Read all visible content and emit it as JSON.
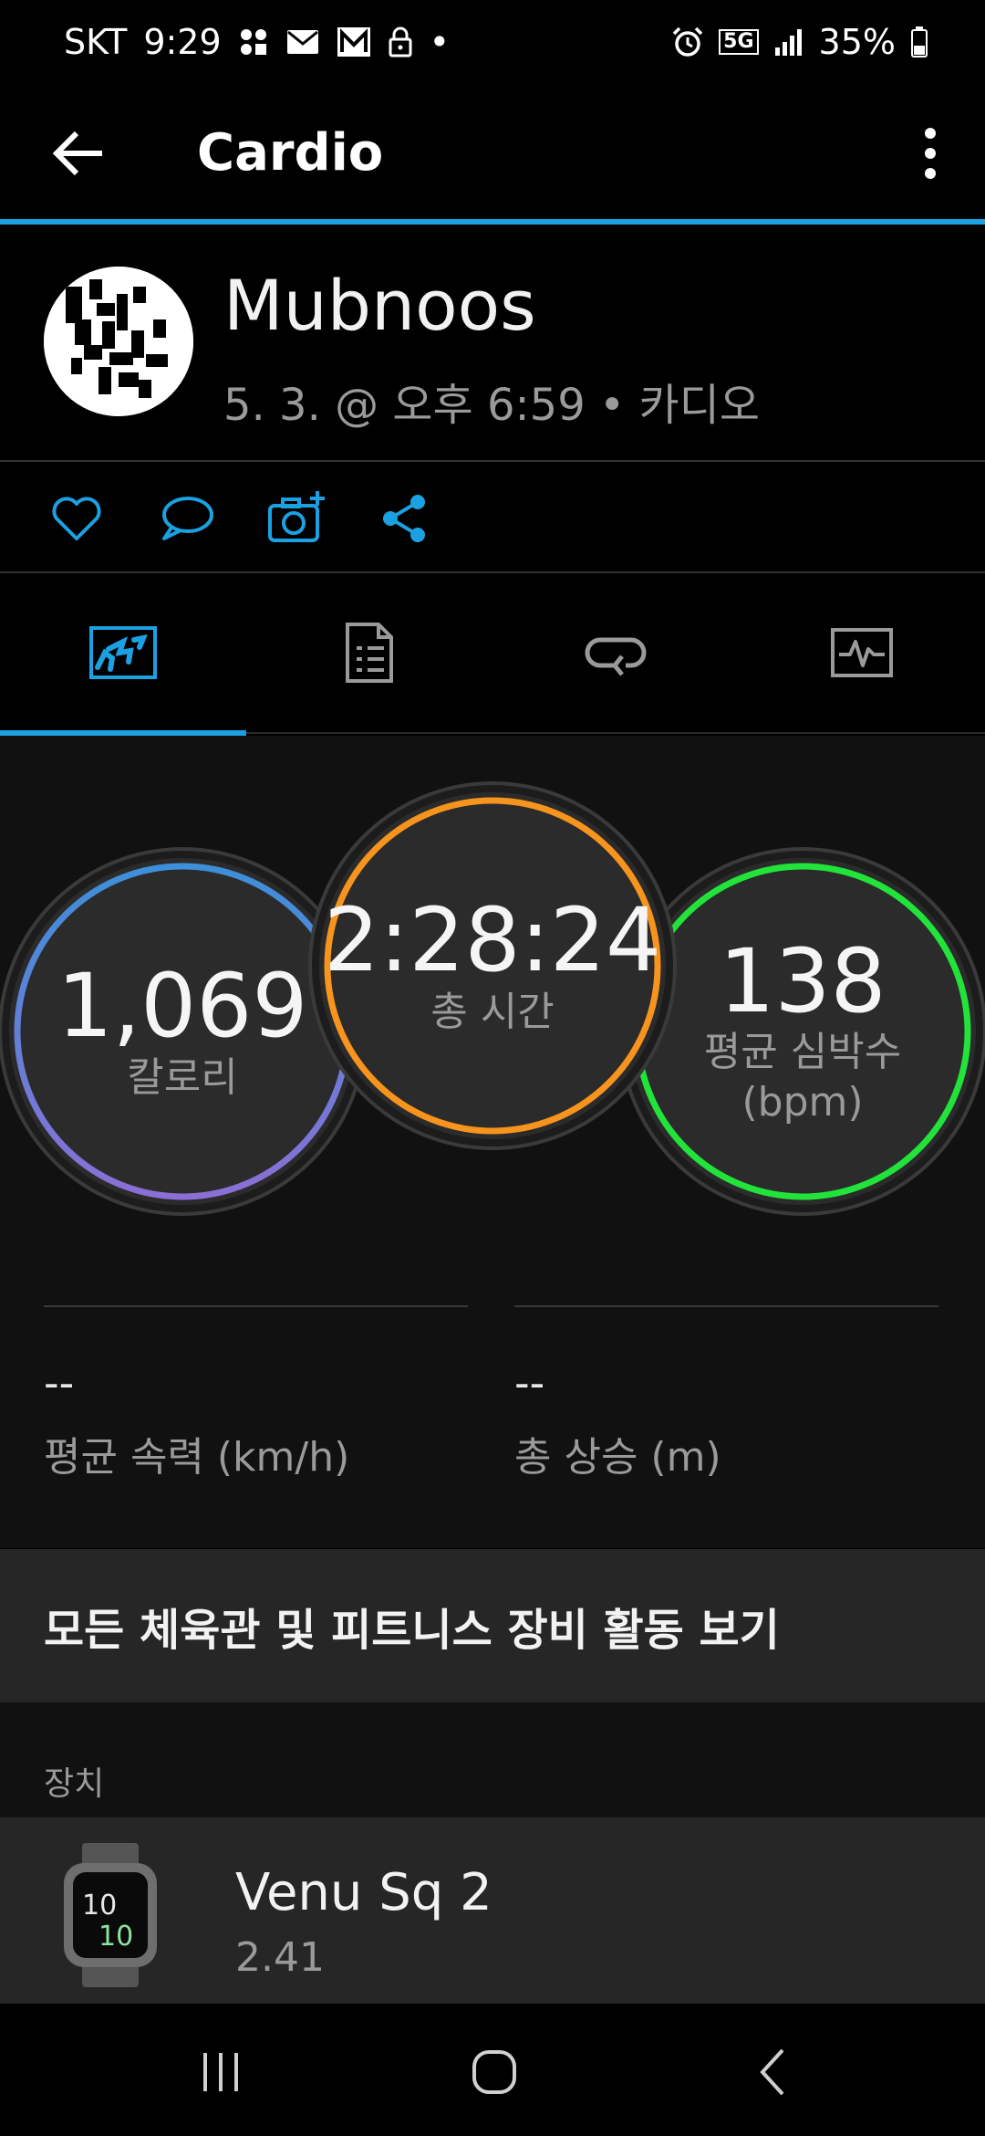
{
  "status_bar": {
    "carrier": "SKT",
    "time": "9:29",
    "dot": "•",
    "network": "5G",
    "battery": "35%"
  },
  "appbar": {
    "title": "Cardio"
  },
  "activity": {
    "user_name": "Mubnoos",
    "meta": "5. 3. @ 오후 6:59 • 카디오"
  },
  "tabs": [
    {
      "icon": "stats-tab-icon",
      "active": true
    },
    {
      "icon": "details-tab-icon",
      "active": false
    },
    {
      "icon": "laps-tab-icon",
      "active": false
    },
    {
      "icon": "chart-tab-icon",
      "active": false
    }
  ],
  "summary": {
    "calories": {
      "value": "1,069",
      "label": "칼로리"
    },
    "total_time": {
      "value": "2:28:24",
      "label": "총 시간"
    },
    "avg_hr": {
      "value": "138",
      "label": "평균 심박수",
      "unit": "(bpm)"
    },
    "avg_speed": {
      "value": "--",
      "label": "평균 속력 (km/h)"
    },
    "total_ascent": {
      "value": "--",
      "label": "총 상승 (m)"
    }
  },
  "gym_link": {
    "label": "모든 체육관 및 피트니스 장비 활동 보기"
  },
  "device": {
    "section_label": "장치",
    "name": "Venu Sq 2",
    "version": "2.41",
    "watch_face": "10"
  },
  "colors": {
    "accent": "#1ba1e2",
    "calories_ring_top": "#3d8fd9",
    "calories_ring_bottom": "#8a6fd6",
    "time_ring": "#f7941d",
    "hr_ring": "#22e33a"
  }
}
